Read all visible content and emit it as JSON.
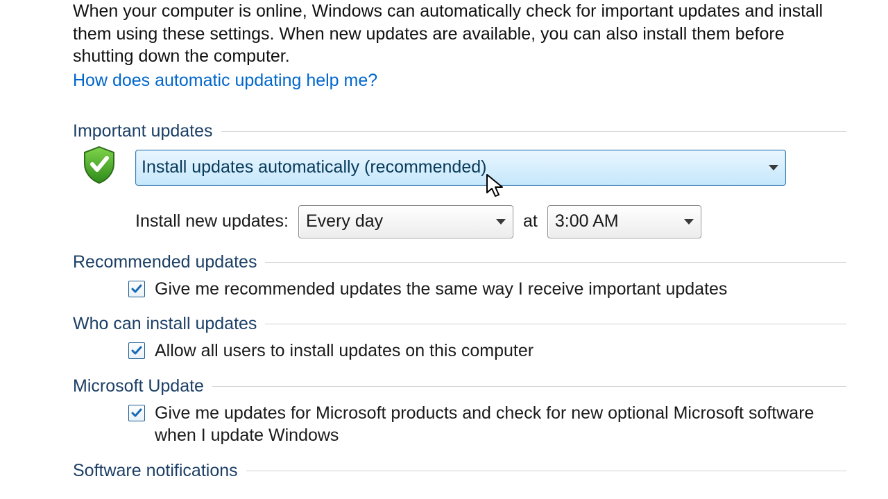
{
  "intro": "When your computer is online, Windows can automatically check for important updates and install them using these settings. When new updates are available, you can also install them before shutting down the computer.",
  "help_link": "How does automatic updating help me?",
  "sections": {
    "important": {
      "legend": "Important updates",
      "main_option": "Install updates automatically (recommended)",
      "schedule_label": "Install new updates:",
      "freq": "Every day",
      "at": "at",
      "time": "3:00 AM"
    },
    "recommended": {
      "legend": "Recommended updates",
      "checkbox": "Give me recommended updates the same way I receive important updates"
    },
    "who": {
      "legend": "Who can install updates",
      "checkbox": "Allow all users to install updates on this computer"
    },
    "msupdate": {
      "legend": "Microsoft Update",
      "checkbox": "Give me updates for Microsoft products and check for new optional Microsoft software when I update Windows"
    },
    "software": {
      "legend": "Software notifications"
    }
  }
}
